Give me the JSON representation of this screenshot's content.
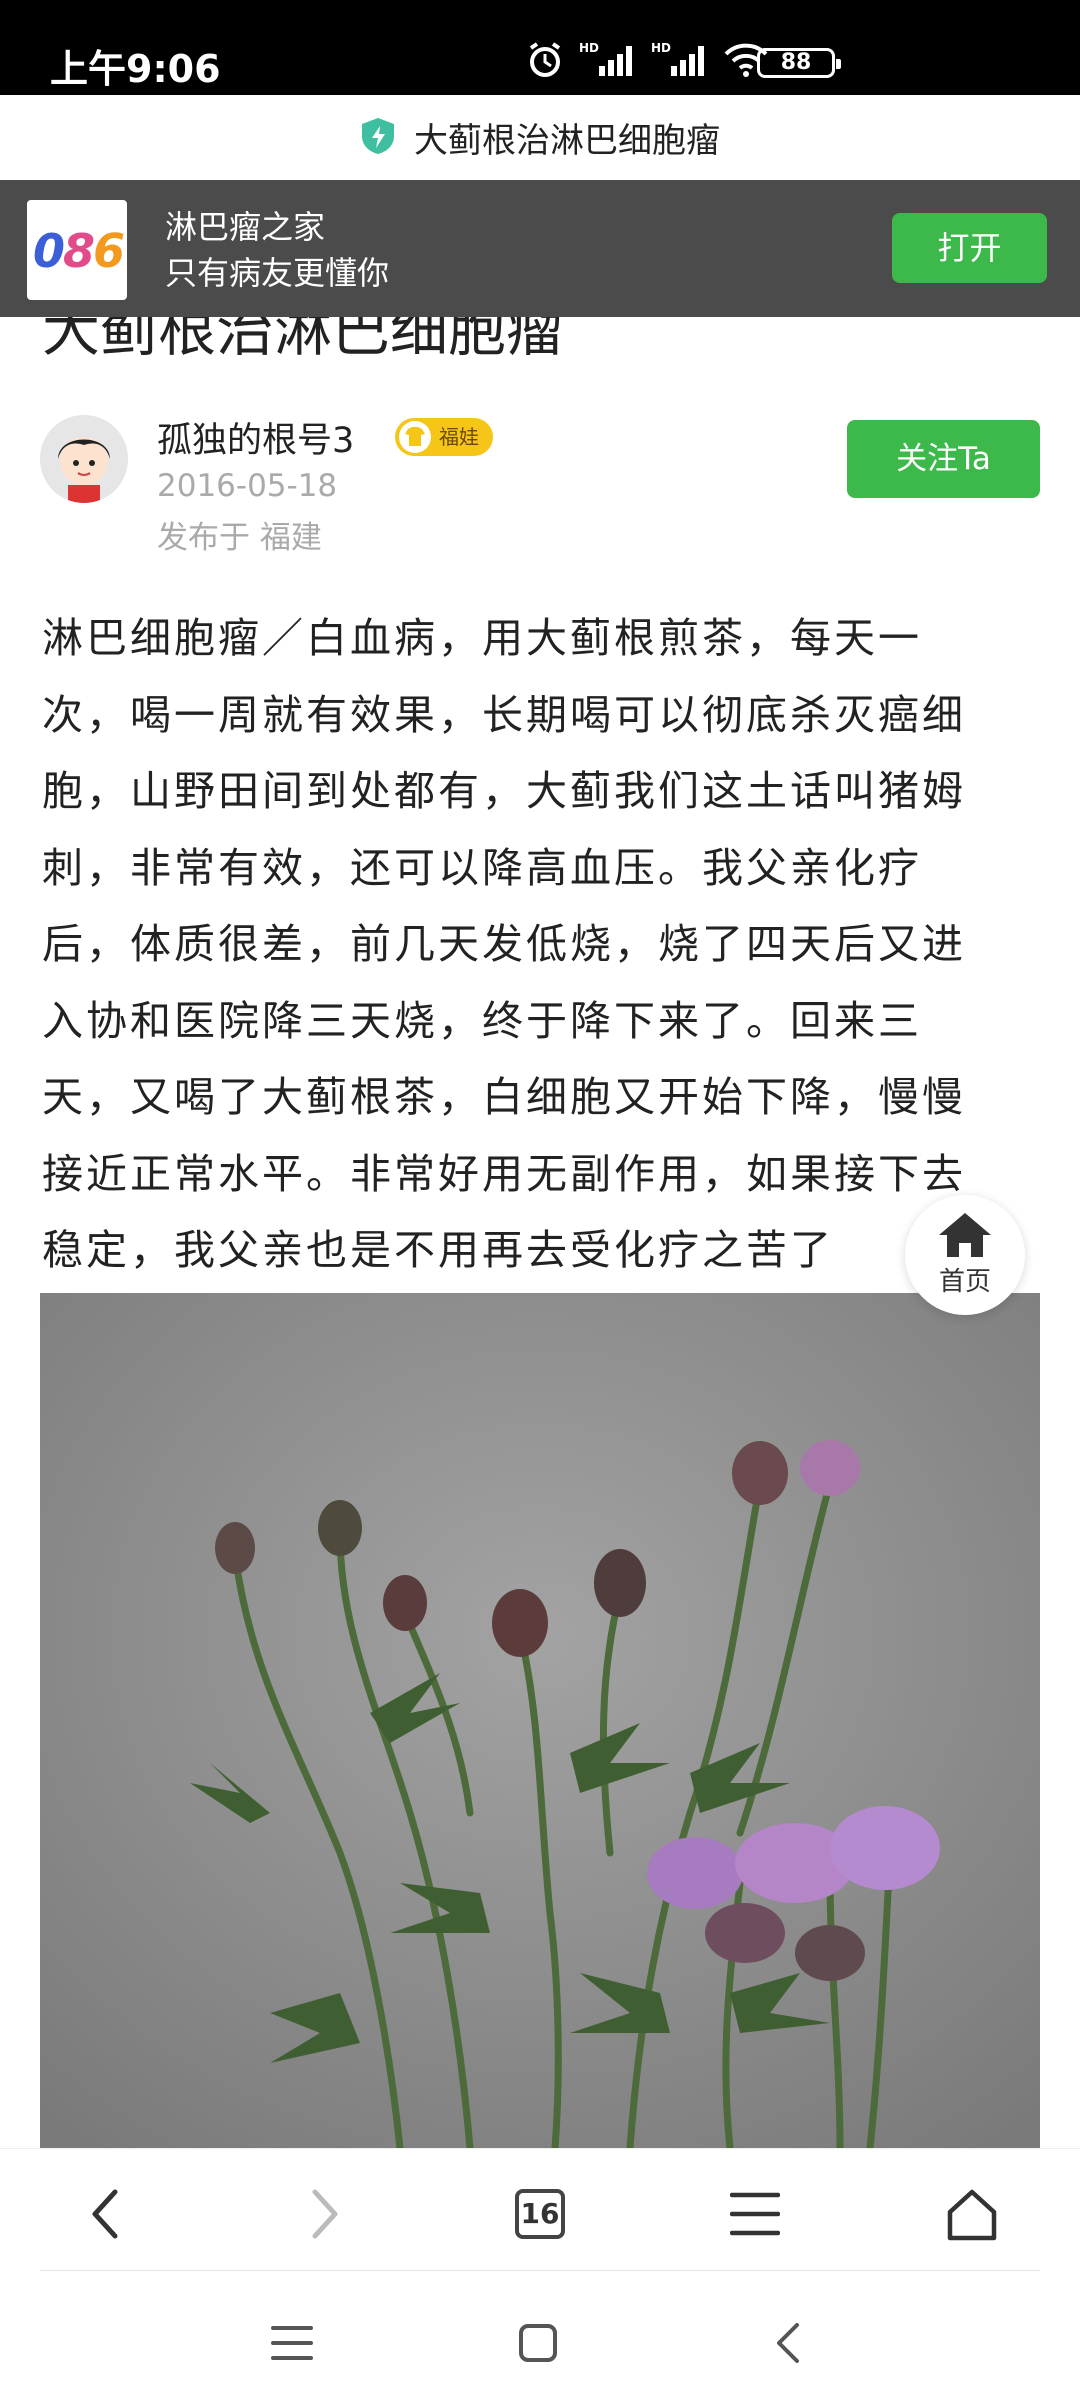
{
  "status": {
    "time": "上午9:06",
    "battery": "88"
  },
  "url_bar": {
    "title": "大蓟根治淋巴细胞瘤"
  },
  "app_banner": {
    "logo_text": "086",
    "app_name": "淋巴瘤之家",
    "slogan": "只有病友更懂你",
    "open_label": "打开"
  },
  "article": {
    "title": "大蓟根治淋巴细胞瘤",
    "author": {
      "name": "孤独的根号3",
      "badge": "福娃",
      "date": "2016-05-18",
      "location": "发布于 福建"
    },
    "follow_label": "关注Ta",
    "body_lines": [
      "淋巴细胞瘤／白血病，用大蓟根煎茶，每天一",
      "次，喝一周就有效果，长期喝可以彻底杀灭癌细",
      "胞，山野田间到处都有，大蓟我们这土话叫猪姆",
      "刺，非常有效，还可以降高血压。我父亲化疗",
      "后，体质很差，前几天发低烧，烧了四天后又进",
      "入协和医院降三天烧，终于降下来了。回来三",
      "天，又喝了大蓟根茶，白细胞又开始下降，慢慢",
      "接近正常水平。非常好用无副作用，如果接下去",
      "稳定，我父亲也是不用再去受化疗之苦了"
    ]
  },
  "home_float": {
    "label": "首页"
  },
  "toolbar": {
    "tab_count": "16"
  },
  "colors": {
    "accent_green": "#3db84a",
    "banner_bg": "#4b4b4b",
    "badge_yellow": "#f5c518"
  }
}
